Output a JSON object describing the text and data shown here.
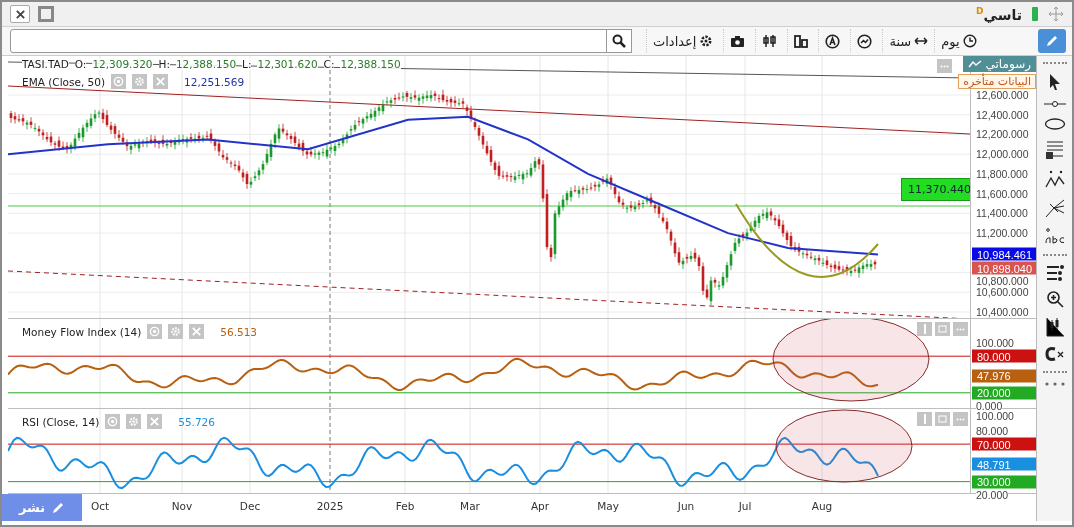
{
  "title_bar": {
    "symbol": "تاسي",
    "interval_badge": "D"
  },
  "toolbar": {
    "settings_label": "إعدادات",
    "range_buttons": [
      {
        "label": "يوم"
      },
      {
        "label": "سنة"
      }
    ]
  },
  "chart": {
    "symbol": "TASI.TAD",
    "ohlc": [
      {
        "label": "O:",
        "value": "12,309.320"
      },
      {
        "label": "H:",
        "value": "12,388.150"
      },
      {
        "label": "L:",
        "value": "12,301.620"
      },
      {
        "label": "C:",
        "value": "12,388.150"
      }
    ],
    "my_drawings": "رسوماتي",
    "data_notice": "البيانات متأخره",
    "overlay": {
      "name": "EMA  (Close, 50)",
      "value": "12,251.569"
    },
    "level_label": "11,370.440",
    "axis_labels": [
      "12,600.000",
      "12,400.000",
      "12,200.000",
      "12,000.000",
      "11,800.000",
      "11,600.000",
      "11,400.000",
      "11,200.000",
      "10,800.000",
      "10,600.000",
      "10,400.000"
    ],
    "price_tags": [
      {
        "text": "10,984.461",
        "color": "#0a0ae6"
      },
      {
        "text": "10,898.040",
        "color": "#d9534f"
      }
    ]
  },
  "panels": [
    {
      "kind": "mfi",
      "name": "Money Flow Index  (14)",
      "value": "56.513",
      "color": "#b8600f",
      "axis_labels": [
        "100.000",
        "0.000"
      ],
      "tags": [
        {
          "text": "80.000",
          "color": "#cc1111"
        },
        {
          "text": "47.976",
          "color": "#b8600f"
        },
        {
          "text": "20.000",
          "color": "#22aa22"
        }
      ]
    },
    {
      "kind": "rsi",
      "name": "RSI  (Close, 14)",
      "value": "55.726",
      "color": "#1a8fe0",
      "axis_labels": [
        "100.000",
        "80.000",
        "20.000"
      ],
      "tags": [
        {
          "text": "70.000",
          "color": "#cc1111"
        },
        {
          "text": "48.791",
          "color": "#1a8fe0"
        },
        {
          "text": "30.000",
          "color": "#22aa22"
        }
      ]
    }
  ],
  "x_axis": [
    "Oct",
    "Nov",
    "Dec",
    "2025",
    "Feb",
    "Mar",
    "Apr",
    "May",
    "Jun",
    "Jul",
    "Aug"
  ],
  "publish_button": "نشر"
}
